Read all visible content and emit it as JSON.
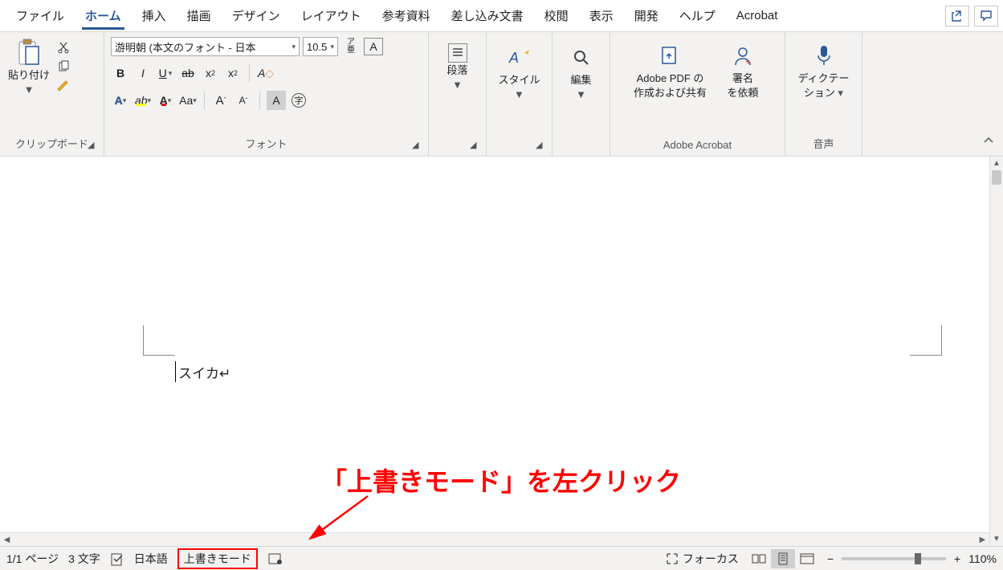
{
  "tabs": {
    "file": "ファイル",
    "home": "ホーム",
    "insert": "挿入",
    "draw": "描画",
    "design": "デザイン",
    "layout": "レイアウト",
    "references": "参考資料",
    "mailings": "差し込み文書",
    "review": "校閲",
    "view": "表示",
    "developer": "開発",
    "help": "ヘルプ",
    "acrobat": "Acrobat"
  },
  "ribbon": {
    "clipboard": {
      "paste": "貼り付け",
      "label": "クリップボード"
    },
    "font": {
      "name": "游明朝 (本文のフォント - 日本",
      "size": "10.5",
      "label": "フォント"
    },
    "paragraph": {
      "button": "段落",
      "label": ""
    },
    "styles": {
      "button": "スタイル"
    },
    "editing": {
      "button": "編集"
    },
    "adobe": {
      "pdf_line1": "Adobe PDF の",
      "pdf_line2": "作成および共有",
      "sign_line1": "署名",
      "sign_line2": "を依頼",
      "label": "Adobe Acrobat"
    },
    "voice": {
      "dictate_line1": "ディクテー",
      "dictate_line2": "ション",
      "label": "音声"
    }
  },
  "document": {
    "body_text": "スイカ↵"
  },
  "annotation": {
    "text": "「上書きモード」を左クリック"
  },
  "status": {
    "page": "1/1 ページ",
    "chars": "3 文字",
    "lang": "日本語",
    "overwrite": "上書きモード",
    "focus": "フォーカス",
    "zoom": "110%"
  }
}
